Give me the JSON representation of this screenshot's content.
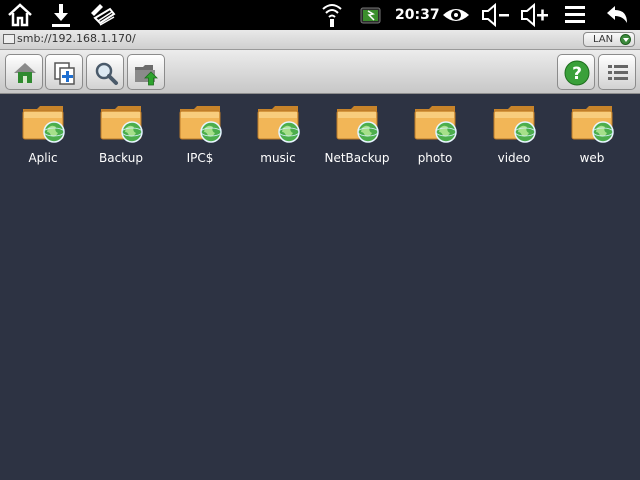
{
  "status_bar": {
    "time": "20:37",
    "icons": [
      "home-icon",
      "download-icon",
      "usb-debug-icon",
      "wifi-icon",
      "battery-icon",
      "eye-icon",
      "volume-down-icon",
      "volume-up-icon",
      "menu-icon",
      "back-icon"
    ]
  },
  "path_bar": {
    "path": "smb://192.168.1.170/",
    "network_selector": "LAN"
  },
  "toolbar": {
    "left_buttons": [
      "home-icon",
      "new-window-icon",
      "search-icon",
      "upload-folder-icon"
    ],
    "right_buttons": [
      "help-icon",
      "list-view-icon"
    ]
  },
  "folders": [
    {
      "label": "Aplic"
    },
    {
      "label": "Backup"
    },
    {
      "label": "IPC$"
    },
    {
      "label": "music"
    },
    {
      "label": "NetBackup"
    },
    {
      "label": "photo"
    },
    {
      "label": "video"
    },
    {
      "label": "web"
    }
  ],
  "colors": {
    "background": "#2d3343",
    "statusbar": "#000000",
    "folder": "#e8a63a",
    "globe": "#47b04a"
  }
}
